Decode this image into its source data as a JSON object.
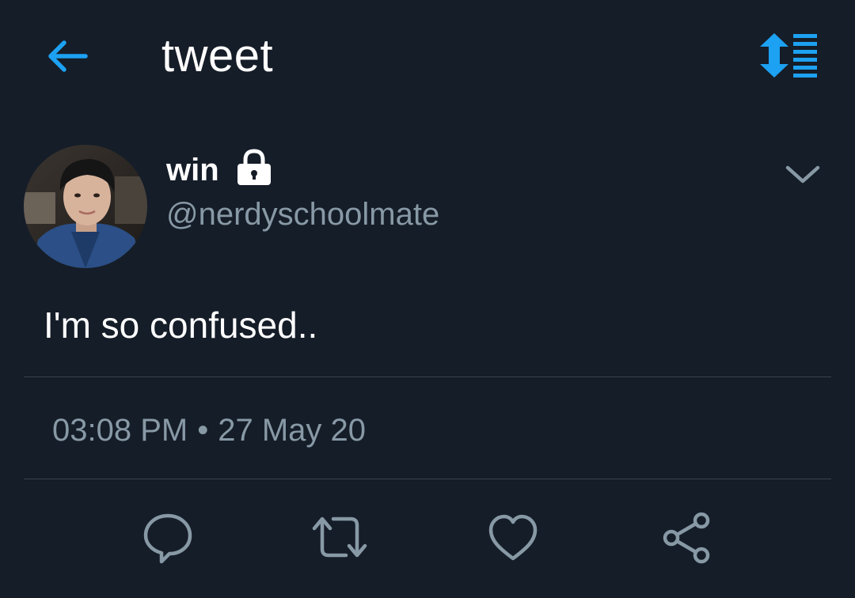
{
  "header": {
    "title": "tweet",
    "back_icon": "arrow-left-icon",
    "thread_icon": "sort-list-icon",
    "accent_color": "#1da1f2"
  },
  "tweet": {
    "display_name": "win",
    "handle": "@nerdyschoolmate",
    "protected": true,
    "text": "I'm so confused..",
    "time": "03:08 PM",
    "separator": "•",
    "date": "27 May 20"
  },
  "actions": [
    {
      "name": "reply",
      "icon": "speech-bubble-icon"
    },
    {
      "name": "retweet",
      "icon": "retweet-icon"
    },
    {
      "name": "like",
      "icon": "heart-icon"
    },
    {
      "name": "share",
      "icon": "share-icon"
    }
  ],
  "colors": {
    "background": "#151d28",
    "secondary_text": "#8899a6",
    "divider": "#38444d",
    "action_icon": "#8899a6"
  }
}
